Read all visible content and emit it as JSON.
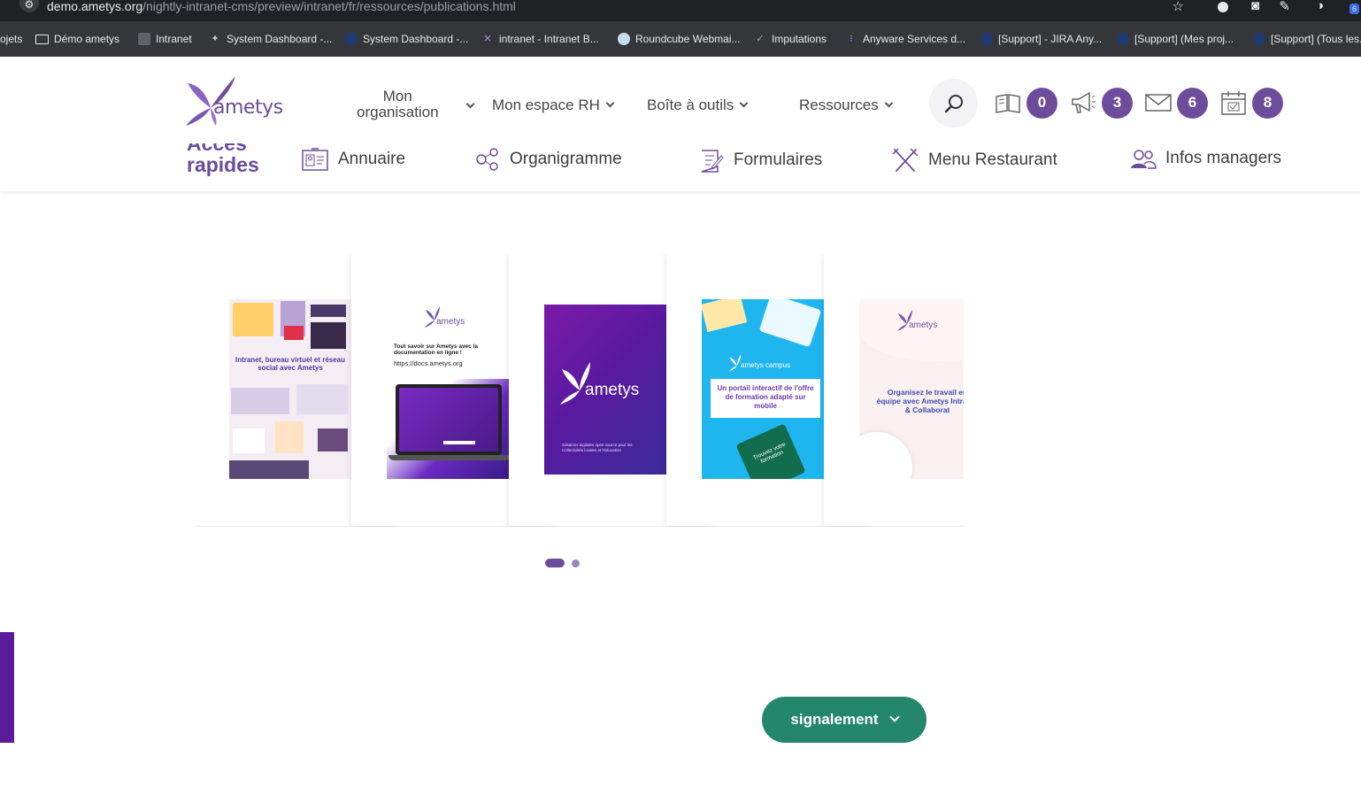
{
  "browser": {
    "url_host": "demo.ametys.org",
    "url_path": "/nightly-intranet-cms/preview/intranet/fr/ressources/publications.html",
    "bookmarks": [
      {
        "label": "ojets",
        "icon": "folder-icon"
      },
      {
        "label": "Démo ametys",
        "icon": "folder-icon"
      },
      {
        "label": "Intranet",
        "icon": "page-icon"
      },
      {
        "label": "System Dashboard -...",
        "icon": "jira-icon"
      },
      {
        "label": "System Dashboard -...",
        "icon": "jira-icon"
      },
      {
        "label": "intranet - Intranet B...",
        "icon": "ametys-icon"
      },
      {
        "label": "Roundcube Webmai...",
        "icon": "roundcube-icon"
      },
      {
        "label": "Imputations",
        "icon": "check-icon"
      },
      {
        "label": "Anyware Services d...",
        "icon": "anyware-icon"
      },
      {
        "label": "[Support] - JIRA Any...",
        "icon": "jira-icon"
      },
      {
        "label": "[Support] (Mes proj...",
        "icon": "jira-icon"
      },
      {
        "label": "[Support] (Tous les...",
        "icon": "jira-icon"
      }
    ],
    "extension_badge": "6"
  },
  "header": {
    "logo_text": "ametys",
    "nav": {
      "org_line1": "Mon",
      "org_line2": "organisation",
      "rh": "Mon espace RH",
      "tools": "Boîte à outils",
      "resources": "Ressources"
    },
    "counters": {
      "publications": "0",
      "announcements": "3",
      "mail": "6",
      "calendar": "8"
    },
    "quick_access": {
      "title_line1": "Accès",
      "title_line2": "rapides",
      "items": [
        "Annuaire",
        "Organigramme",
        "Formulaires",
        "Menu Restaurant",
        "Infos managers"
      ]
    }
  },
  "carousel": {
    "cards": [
      {
        "caption": "Intranet, bureau virtuel et réseau social avec Ametys"
      },
      {
        "caption": "Tout savoir sur Ametys avec la documentation en ligne !",
        "link": "https://docs.ametys.org",
        "logo": "ametys"
      },
      {
        "logo": "ametys",
        "footer": "Solutions digitales open source pour les Collectivités locales et l'éducation"
      },
      {
        "logo": "ametys campus",
        "caption": "Un portail interactif de l'offre de formation adapté sur mobile",
        "tag": "Trouvez votre formation"
      },
      {
        "logo": "ametys",
        "caption": "Organisez le travail en équipe avec Ametys Intranet & Collaborat"
      }
    ],
    "pages": 2,
    "active_page": 1
  },
  "signal_button": "signalement",
  "colors": {
    "brand_purple": "#6e4c9c",
    "signal_green": "#24866a",
    "campus_blue": "#1fb6f0"
  }
}
